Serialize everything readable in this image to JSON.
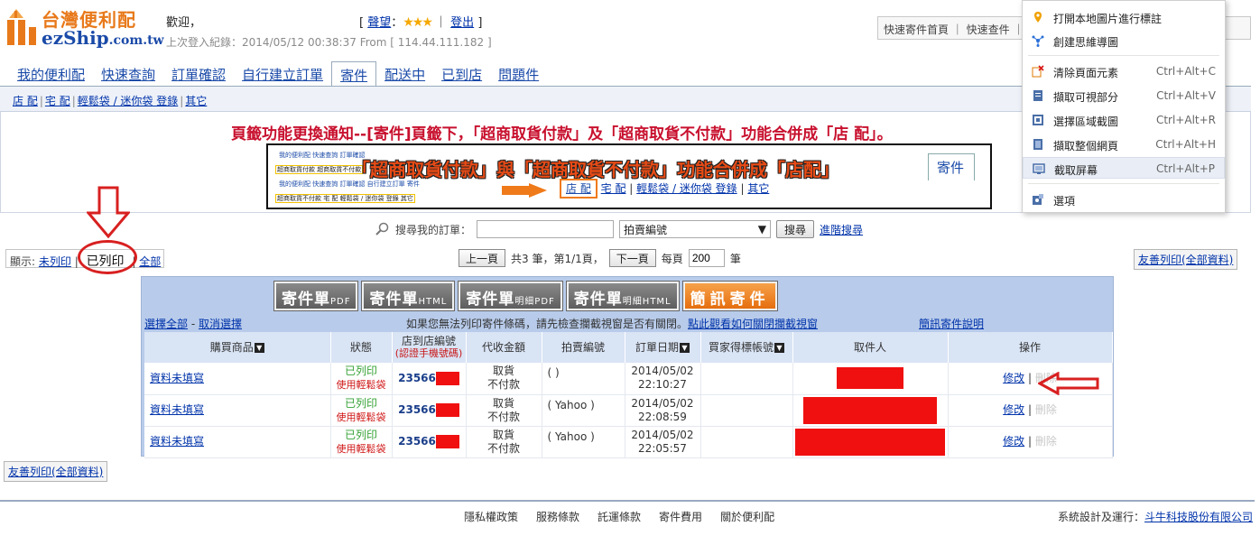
{
  "header": {
    "brand_cn": "台灣便利配",
    "brand_en": "ezShip",
    "brand_en_suffix": ".com.tw",
    "welcome": "歡迎，",
    "last_login": "上次登入紀錄：2014/05/12 00:38:37 From [ 114.44.111.182 ]",
    "level_label": "聲望",
    "level_stars": "★★★",
    "logout": "登出",
    "toplinks": "快速寄件首頁 ｜ 快速查件 ｜ 問題"
  },
  "tabs": [
    {
      "label": "我的便利配"
    },
    {
      "label": "快速查詢"
    },
    {
      "label": "訂單確認"
    },
    {
      "label": "自行建立訂單"
    },
    {
      "label": "寄件"
    },
    {
      "label": "配送中"
    },
    {
      "label": "已到店"
    },
    {
      "label": "問題件"
    }
  ],
  "subnav": [
    "店 配",
    "宅 配",
    "輕鬆袋 / 迷你袋 登錄",
    "其它"
  ],
  "notice": {
    "title": "頁籤功能更換通知--[寄件]頁籤下，「超商取貨付款」及「超商取貨不付款」功能合併成「店 配」。",
    "headline": "「超商取貨付款」與「超商取貨不付款」功能合併成「店配」",
    "tab_label": "寄件",
    "mini_row1": "我的便利配 快速查詢 訂單確認",
    "mini_row1b": "超商取貨付款 超商取貨不付款",
    "mini_row2": "我的便利配 快速查詢 訂單確認 自行建立訂單 寄件",
    "mini_row2b": "超商取貨不付款 宅 配 輕鬆袋 / 迷你袋 登錄 其它",
    "sub_store": "店 配",
    "sub_home": "宅 配",
    "sub_bag": "輕鬆袋 / 迷你袋 登錄",
    "sub_other": "其它"
  },
  "search": {
    "label": "搜尋我的訂單：",
    "input_value": "",
    "select_value": "拍賣編號",
    "search_button": "搜尋",
    "advanced": "進階搜尋"
  },
  "filter": {
    "label": "顯示:",
    "unprinted": "未列印",
    "printed": "已列印",
    "all": "全部"
  },
  "pager": {
    "prev": "上一頁",
    "summary": "共3 筆，第1/1頁，",
    "next": "下一頁",
    "per_page_label": "每頁",
    "per_page_value": "200",
    "unit": "筆"
  },
  "friendly_print": "友善列印(全部資料)",
  "print_buttons": [
    {
      "main": "寄件單",
      "sub": "PDF"
    },
    {
      "main": "寄件單",
      "sub": "HTML"
    },
    {
      "main": "寄件單",
      "sub": "明細PDF"
    },
    {
      "main": "寄件單",
      "sub": "明細HTML"
    },
    {
      "main": "簡訊寄件",
      "sub": ""
    }
  ],
  "selection": {
    "select_all": "選擇全部",
    "dash": " - ",
    "deselect": "取消選擇",
    "warning": "如果您無法列印寄件條碼，請先檢查攔截視窗是否有關閉。",
    "warning_link": "點此觀看如何關閉攔截視窗",
    "sms_help": "簡訊寄件說明"
  },
  "table": {
    "headers": {
      "product": "購買商品",
      "status": "狀態",
      "store_code": "店到店編號",
      "store_code_sub": "(認證手機號碼)",
      "amount": "代收金額",
      "auction": "拍賣編號",
      "date": "訂單日期",
      "buyer": "買家得標帳號",
      "recipient": "取件人",
      "action": "操作"
    },
    "rows": [
      {
        "product": "資料未填寫",
        "status": "已列印",
        "status_sub": "使用輕鬆袋",
        "code": "23566",
        "amount": "取貨",
        "amount_sub": "不付款",
        "auction": "(    )",
        "date": "2014/05/02",
        "time": "22:10:27",
        "edit": "修改",
        "delete": "刪除"
      },
      {
        "product": "資料未填寫",
        "status": "已列印",
        "status_sub": "使用輕鬆袋",
        "code": "23566",
        "amount": "取貨",
        "amount_sub": "不付款",
        "auction": "( Yahoo )",
        "date": "2014/05/02",
        "time": "22:08:59",
        "edit": "修改",
        "delete": "刪除"
      },
      {
        "product": "資料未填寫",
        "status": "已列印",
        "status_sub": "使用輕鬆袋",
        "code": "23566",
        "amount": "取貨",
        "amount_sub": "不付款",
        "auction": "( Yahoo )",
        "date": "2014/05/02",
        "time": "22:05:57",
        "edit": "修改",
        "delete": "刪除"
      }
    ]
  },
  "footer": {
    "links": [
      "隱私權政策",
      "服務條款",
      "託運條款",
      "寄件費用",
      "關於便利配"
    ],
    "credit_label": "系統設計及運行：",
    "credit_company": "斗牛科技股份有限公司"
  },
  "context_menu": {
    "items": [
      {
        "label": "打開本地圖片進行標註",
        "shortcut": "",
        "icon": "map-pin-icon"
      },
      {
        "label": "創建思維導圖",
        "shortcut": "",
        "icon": "mindmap-icon"
      },
      {
        "label": "清除頁面元素",
        "shortcut": "Ctrl+Alt+C",
        "icon": "clear-element-icon"
      },
      {
        "label": "擷取可視部分",
        "shortcut": "Ctrl+Alt+V",
        "icon": "capture-visible-icon"
      },
      {
        "label": "選擇區域截圖",
        "shortcut": "Ctrl+Alt+R",
        "icon": "capture-region-icon"
      },
      {
        "label": "擷取整個網頁",
        "shortcut": "Ctrl+Alt+H",
        "icon": "capture-page-icon"
      },
      {
        "label": "截取屏幕",
        "shortcut": "Ctrl+Alt+P",
        "icon": "capture-screen-icon"
      },
      {
        "label": "選項",
        "shortcut": "",
        "icon": "options-icon"
      }
    ]
  },
  "colors": {
    "brand_orange": "#e8791a",
    "brand_blue": "#1a4aa8",
    "notice_red": "#c8102e",
    "panel_blue": "#b8cbea",
    "annotation_red": "#d82020"
  }
}
